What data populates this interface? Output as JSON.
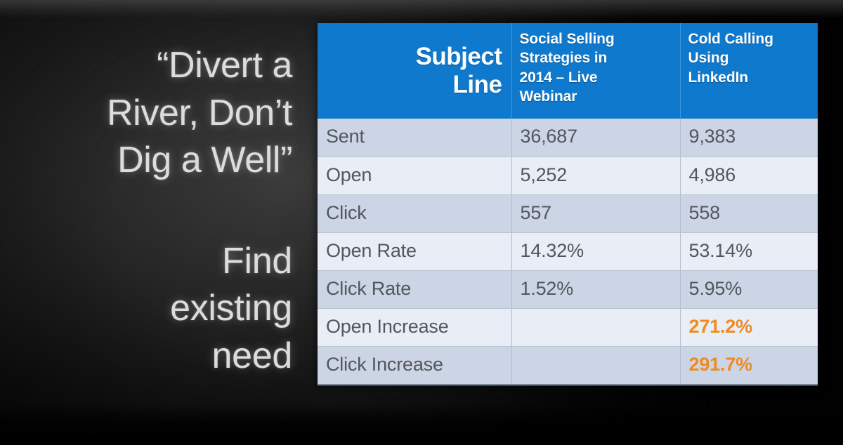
{
  "slide": {
    "quote": "“Divert a\nRiver, Don’t\nDig a Well”",
    "subhead": "Find\nexisting\nneed"
  },
  "colors": {
    "header_blue": "#0f79ce",
    "highlight_orange": "#f08a1e",
    "row_odd": "#ccd5e6",
    "row_even": "#e9eef6",
    "body_text": "#53565c",
    "slide_text": "#dcdcdc"
  },
  "table": {
    "headers": {
      "metric": "Subject\nLine",
      "campaign_a": "Social Selling\nStrategies in\n2014 – Live\nWebinar",
      "campaign_b": "Cold Calling\nUsing\nLinkedIn"
    },
    "rows": [
      {
        "label": "Sent",
        "a": "36,687",
        "b": "9,383",
        "highlight": false
      },
      {
        "label": "Open",
        "a": "5,252",
        "b": "4,986",
        "highlight": false
      },
      {
        "label": "Click",
        "a": "557",
        "b": "558",
        "highlight": false
      },
      {
        "label": "Open Rate",
        "a": "14.32%",
        "b": "53.14%",
        "highlight": false
      },
      {
        "label": "Click Rate",
        "a": "1.52%",
        "b": "5.95%",
        "highlight": false
      },
      {
        "label": "Open Increase",
        "a": "",
        "b": "271.2%",
        "highlight": true
      },
      {
        "label": "Click Increase",
        "a": "",
        "b": "291.7%",
        "highlight": true
      }
    ]
  },
  "chart_data": {
    "type": "table",
    "title": "Subject Line",
    "categories": [
      "Sent",
      "Open",
      "Click",
      "Open Rate",
      "Click Rate",
      "Open Increase",
      "Click Increase"
    ],
    "series": [
      {
        "name": "Social Selling Strategies in 2014 – Live Webinar",
        "values": [
          "36,687",
          "5,252",
          "557",
          "14.32%",
          "1.52%",
          "",
          ""
        ]
      },
      {
        "name": "Cold Calling Using LinkedIn",
        "values": [
          "9,383",
          "4,986",
          "558",
          "53.14%",
          "5.95%",
          "271.2%",
          "291.7%"
        ]
      }
    ],
    "xlabel": "",
    "ylabel": "",
    "grid": true,
    "legend_position": "top"
  }
}
